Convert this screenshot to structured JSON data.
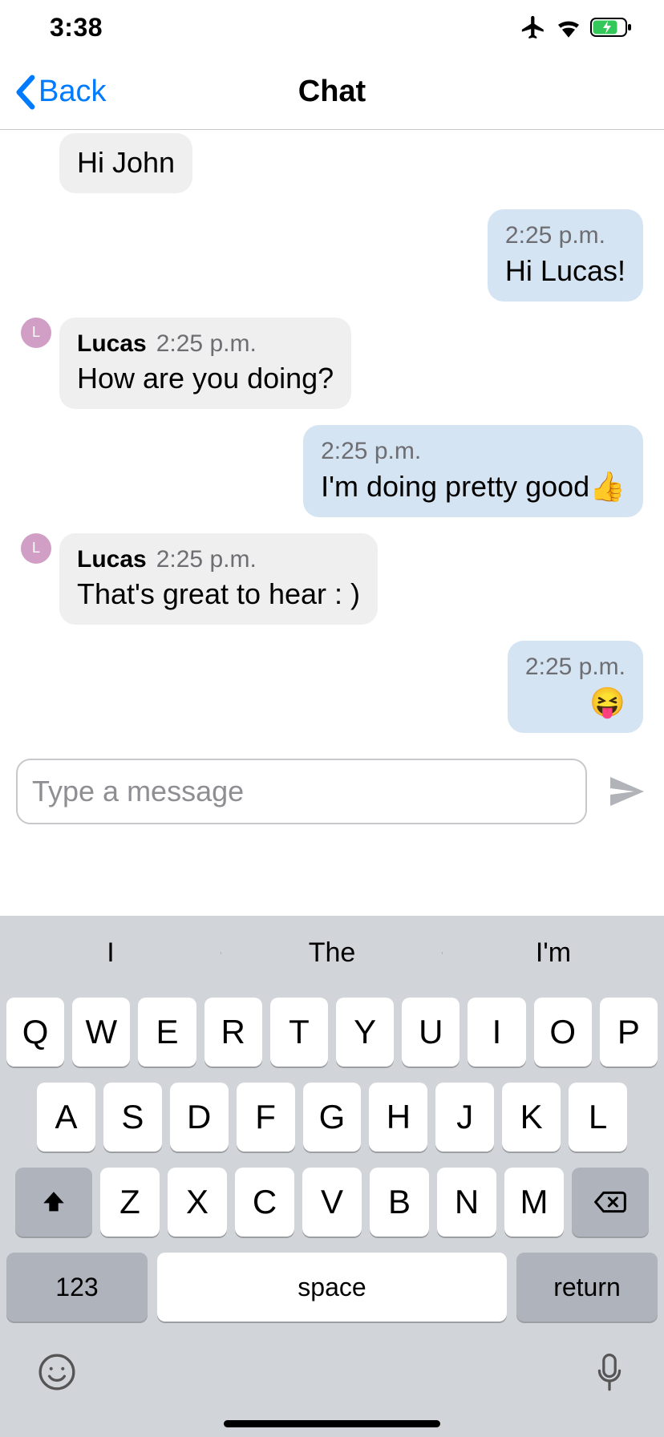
{
  "status": {
    "time": "3:38"
  },
  "nav": {
    "back": "Back",
    "title": "Chat"
  },
  "messages": [
    {
      "side": "in",
      "showAvatar": false,
      "avatarLetter": "",
      "name": "",
      "time": "",
      "text": "Hi John"
    },
    {
      "side": "out",
      "showAvatar": false,
      "avatarLetter": "",
      "name": "",
      "time": "2:25 p.m.",
      "text": "Hi Lucas!"
    },
    {
      "side": "in",
      "showAvatar": true,
      "avatarLetter": "L",
      "name": "Lucas",
      "time": "2:25 p.m.",
      "text": "How are you doing?"
    },
    {
      "side": "out",
      "showAvatar": false,
      "avatarLetter": "",
      "name": "",
      "time": "2:25 p.m.",
      "text": "I'm doing pretty good👍"
    },
    {
      "side": "in",
      "showAvatar": true,
      "avatarLetter": "L",
      "name": "Lucas",
      "time": "2:25 p.m.",
      "text": "That's great to hear : )"
    },
    {
      "side": "out",
      "showAvatar": false,
      "avatarLetter": "",
      "name": "",
      "time": "2:25 p.m.",
      "text": "😝"
    }
  ],
  "input": {
    "placeholder": "Type a message",
    "value": ""
  },
  "keyboard": {
    "suggestions": [
      "I",
      "The",
      "I'm"
    ],
    "row1": [
      "Q",
      "W",
      "E",
      "R",
      "T",
      "Y",
      "U",
      "I",
      "O",
      "P"
    ],
    "row2": [
      "A",
      "S",
      "D",
      "F",
      "G",
      "H",
      "J",
      "K",
      "L"
    ],
    "row3": [
      "Z",
      "X",
      "C",
      "V",
      "B",
      "N",
      "M"
    ],
    "numKey": "123",
    "spaceKey": "space",
    "returnKey": "return"
  }
}
